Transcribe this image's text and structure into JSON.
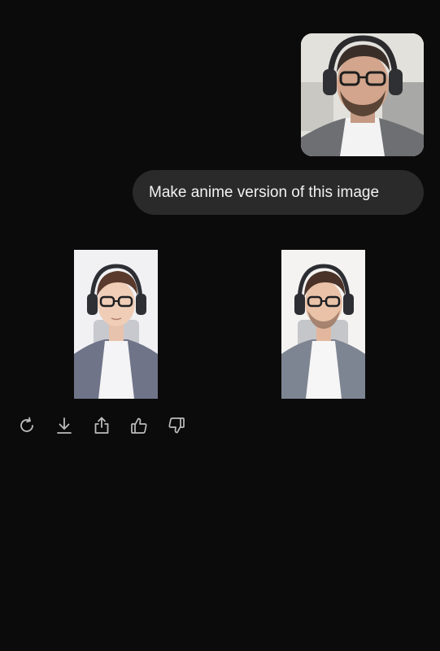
{
  "conversation": {
    "user_message": {
      "attachment_icon": "user-portrait-photo",
      "text": "Make anime version of this image"
    },
    "assistant_reply": {
      "images": [
        {
          "icon": "anime-portrait-illustration"
        },
        {
          "icon": "anime-portrait-illustration"
        }
      ],
      "actions": [
        {
          "icon": "regenerate-icon"
        },
        {
          "icon": "download-icon"
        },
        {
          "icon": "share-icon"
        },
        {
          "icon": "thumbs-up-icon"
        },
        {
          "icon": "thumbs-down-icon"
        }
      ]
    }
  },
  "colors": {
    "background": "#0b0b0b",
    "bubble": "#2a2a2a",
    "bubble_text": "#f2f2f2",
    "icon": "#bdbdbd"
  }
}
